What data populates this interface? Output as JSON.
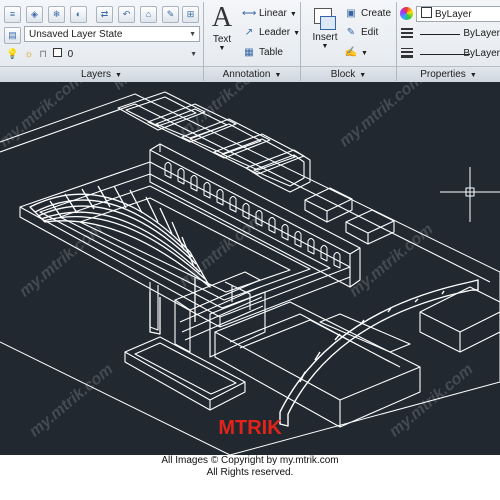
{
  "ribbon": {
    "layers": {
      "title": "Layers",
      "layer_state": "Unsaved Layer State",
      "current_layer": "0"
    },
    "annotation": {
      "title": "Annotation",
      "text_label": "Text",
      "linear_label": "Linear",
      "leader_label": "Leader",
      "table_label": "Table"
    },
    "block": {
      "title": "Block",
      "insert_label": "Insert",
      "create_label": "Create",
      "edit_label": "Edit"
    },
    "properties": {
      "title": "Properties",
      "color": "ByLayer",
      "linetype": "ByLayer",
      "lineweight": "ByLayer"
    }
  },
  "watermark": {
    "site": "my.mtrik.com",
    "brand": "MTRIK"
  },
  "footer": {
    "logo": "MTRIK",
    "copyright": "All Images © Copyright by my.mtrik.com",
    "rights": "All Rights reserved."
  },
  "colors": {
    "canvas_bg": "#212830",
    "linework": "#ffffff",
    "logo_red": "#e2231a"
  }
}
